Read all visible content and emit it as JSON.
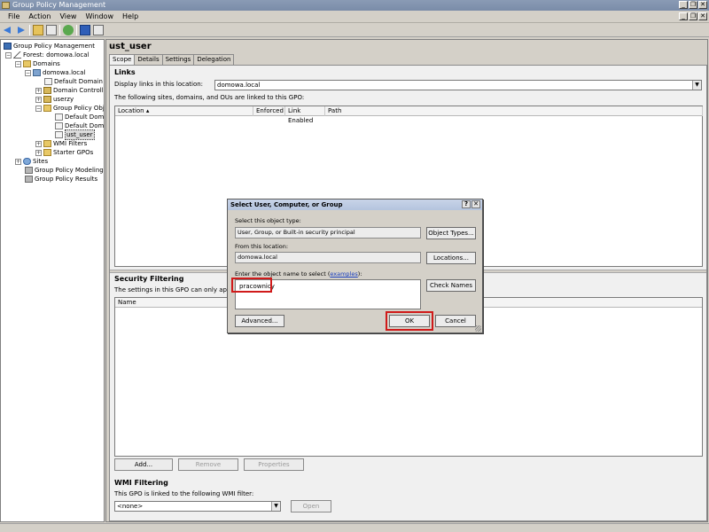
{
  "window": {
    "title": "Group Policy Management",
    "minimize": "_",
    "restore": "❐",
    "close": "✕"
  },
  "menu": {
    "items": [
      "File",
      "Action",
      "View",
      "Window",
      "Help"
    ],
    "child_min": "_",
    "child_restore": "❐",
    "child_close": "✕"
  },
  "tree": {
    "root": "Group Policy Management",
    "forest": "Forest: domowa.local",
    "domains": "Domains",
    "domain": "domowa.local",
    "default_domain": "Default Domain Po",
    "domain_controllers": "Domain Controller",
    "userzy": "userzy",
    "gpo_folder": "Group Policy Obje",
    "gpo1": "Default Doma",
    "gpo2": "Default Doma",
    "gpo3": "ust_user",
    "wmi": "WMI Filters",
    "starter": "Starter GPOs",
    "sites": "Sites",
    "modeling": "Group Policy Modeling",
    "results": "Group Policy Results",
    "expand_minus": "−",
    "expand_plus": "+"
  },
  "main": {
    "title": "ust_user",
    "tabs": [
      "Scope",
      "Details",
      "Settings",
      "Delegation"
    ],
    "links": {
      "heading": "Links",
      "display_label": "Display links in this location:",
      "location_value": "domowa.local",
      "linked_text": "The following sites, domains, and OUs are linked to this GPO:",
      "columns": [
        "Location",
        "Enforced",
        "Link Enabled",
        "Path"
      ]
    },
    "security": {
      "heading": "Security Filtering",
      "text": "The settings in this GPO can only apply to th",
      "columns": [
        "Name"
      ],
      "buttons": [
        "Add...",
        "Remove",
        "Properties"
      ]
    },
    "wmi": {
      "heading": "WMI Filtering",
      "text": "This GPO is linked to the following WMI filter:",
      "filter_value": "<none>",
      "open_button": "Open"
    }
  },
  "dialog": {
    "title": "Select User, Computer, or Group",
    "help": "?",
    "close": "✕",
    "object_type_label": "Select this object type:",
    "object_type_value": "User, Group, or Built-in security principal",
    "object_types_button": "Object Types...",
    "location_label": "From this location:",
    "location_value": "domowa.local",
    "locations_button": "Locations...",
    "enter_label": "Enter the object name to select (",
    "examples_link": "examples",
    "enter_label_end": "):",
    "object_name": "pracownicy",
    "check_names_button": "Check Names",
    "advanced_button": "Advanced...",
    "ok_button": "OK",
    "cancel_button": "Cancel"
  },
  "colors": {
    "highlight": "#d01a1a",
    "link": "#1a3fbf",
    "titlebar": "#7a8ca8"
  }
}
